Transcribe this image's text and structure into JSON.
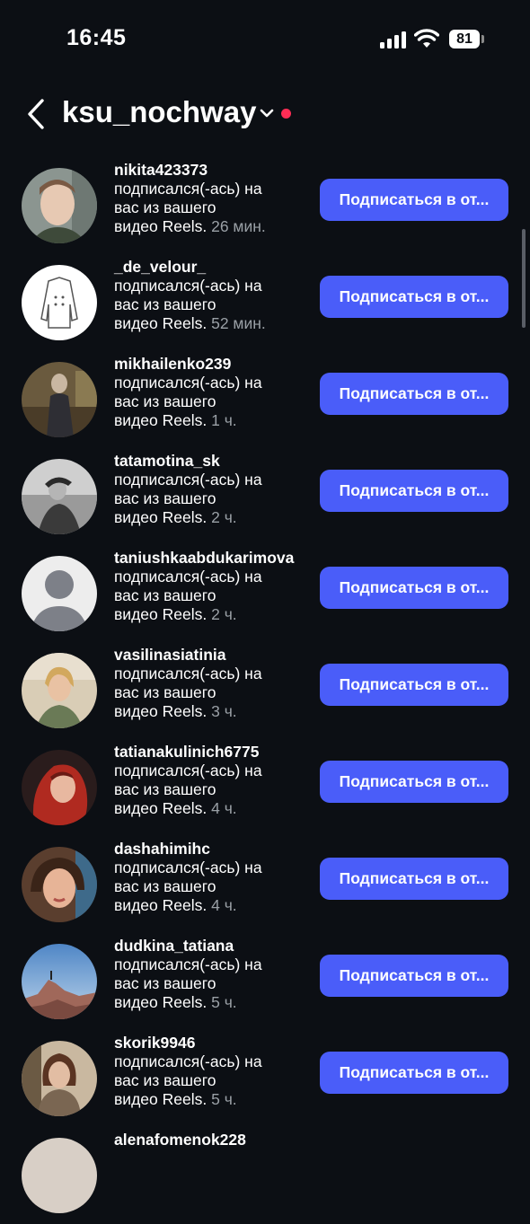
{
  "status_bar": {
    "time": "16:45",
    "battery": "81"
  },
  "header": {
    "username": "ksu_nochway"
  },
  "notification_text": {
    "line1": "подписался(-ась) на",
    "line2": "вас из вашего",
    "line3_prefix": "видео Reels."
  },
  "button_label": "Подписаться в от...",
  "notifications": [
    {
      "username": "nikita423373",
      "time": "26 мин.",
      "avatar": "boy-photo"
    },
    {
      "username": "_de_velour_",
      "time": "52 мин.",
      "avatar": "coat-logo"
    },
    {
      "username": "mikhailenko239",
      "time": "1 ч.",
      "avatar": "woman-room-photo"
    },
    {
      "username": "tatamotina_sk",
      "time": "2 ч.",
      "avatar": "bw-woman-photo"
    },
    {
      "username": "taniushkaabdukarimova",
      "time": "2 ч.",
      "avatar": "default-avatar"
    },
    {
      "username": "vasilinasiatinia",
      "time": "3 ч.",
      "avatar": "blonde-woman-photo"
    },
    {
      "username": "tatianakulinich6775",
      "time": "4 ч.",
      "avatar": "red-hair-woman-photo"
    },
    {
      "username": "dashahimihc",
      "time": "4 ч.",
      "avatar": "woman-selfie-photo"
    },
    {
      "username": "dudkina_tatiana",
      "time": "5 ч.",
      "avatar": "mountain-photo"
    },
    {
      "username": "skorik9946",
      "time": "5 ч.",
      "avatar": "woman-scarf-photo"
    },
    {
      "username": "alenafomenok228",
      "time": "",
      "avatar": "partial-photo"
    }
  ]
}
